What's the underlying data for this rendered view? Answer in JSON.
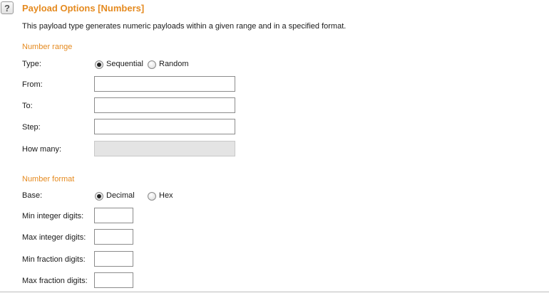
{
  "header": {
    "help_glyph": "?",
    "title": "Payload Options [Numbers]",
    "description": "This payload type generates numeric payloads within a given range and in a specified format."
  },
  "number_range": {
    "heading": "Number range",
    "type_label": "Type:",
    "type_options": [
      "Sequential",
      "Random"
    ],
    "type_selected": "Sequential",
    "from_label": "From:",
    "from_value": "",
    "to_label": "To:",
    "to_value": "",
    "step_label": "Step:",
    "step_value": "",
    "how_many_label": "How many:",
    "how_many_value": ""
  },
  "number_format": {
    "heading": "Number format",
    "base_label": "Base:",
    "base_options": [
      "Decimal",
      "Hex"
    ],
    "base_selected": "Decimal",
    "min_integer_label": "Min integer digits:",
    "min_integer_value": "",
    "max_integer_label": "Max integer digits:",
    "max_integer_value": "",
    "min_fraction_label": "Min fraction digits:",
    "min_fraction_value": "",
    "max_fraction_label": "Max fraction digits:",
    "max_fraction_value": ""
  },
  "colors": {
    "accent": "#e58a1f",
    "text": "#1a1a1a",
    "field_border": "#8c8c8c",
    "disabled_bg": "#e4e4e4"
  }
}
